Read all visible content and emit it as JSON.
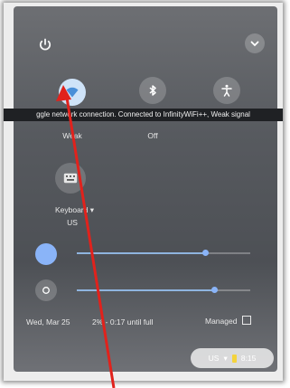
{
  "tooltip": "ggle network connection. Connected to InfinityWiFi++, Weak signal",
  "network": {
    "status": "Weak"
  },
  "bluetooth": {
    "status": "Off"
  },
  "keyboard": {
    "label": "Keyboard",
    "sub": "US"
  },
  "footer": {
    "date": "Wed, Mar 25",
    "battery": "2% - 0:17 until full",
    "managed": "Managed"
  },
  "tray": {
    "locale": "US",
    "time": "8:15"
  },
  "levels": {
    "volume": 0.74,
    "brightness": 0.79
  },
  "colors": {
    "accent": "#8ab4f8",
    "annotation_arrow": "#e1221c"
  }
}
